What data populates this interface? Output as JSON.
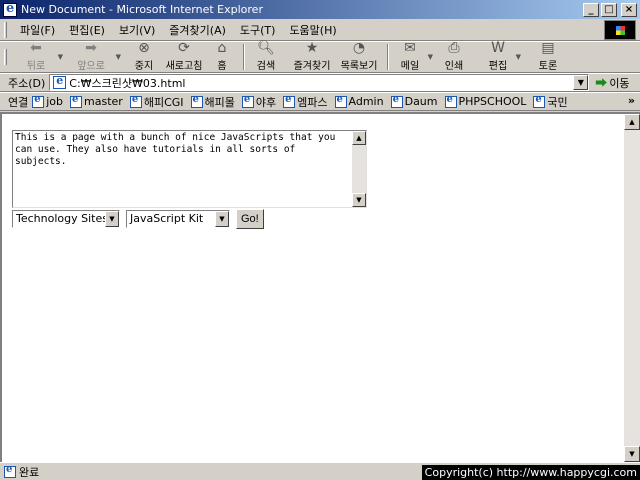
{
  "window": {
    "title": "New Document - Microsoft Internet Explorer",
    "min": "_",
    "max": "□",
    "close": "×"
  },
  "menu": {
    "items": [
      "파일(F)",
      "편집(E)",
      "보기(V)",
      "즐겨찾기(A)",
      "도구(T)",
      "도움말(H)"
    ]
  },
  "toolbar": {
    "back": "뒤로",
    "forward": "앞으로",
    "stop": "중지",
    "refresh": "새로고침",
    "home": "홈",
    "search": "검색",
    "favorites": "즐겨찾기",
    "history": "목록보기",
    "mail": "메일",
    "print": "인쇄",
    "edit": "편집",
    "discuss": "토론"
  },
  "address": {
    "label": "주소(D)",
    "value": "C:₩스크린샷₩03.html",
    "go": "이동"
  },
  "links": {
    "label": "연결",
    "items": [
      "job",
      "master",
      "해피CGI",
      "해피몰",
      "야후",
      "엠파스",
      "Admin",
      "Daum",
      "PHPSCHOOL",
      "국민"
    ],
    "more": "»"
  },
  "page": {
    "textarea": "This is a page with a bunch of nice JavaScripts that you can use. They also have tutorials in all sorts of subjects.",
    "select1": "Technology Sites",
    "select2": "JavaScript Kit",
    "go_button": "Go!"
  },
  "status": {
    "text": "완료",
    "copyright": "Copyright(c) http://www.happycgi.com"
  }
}
